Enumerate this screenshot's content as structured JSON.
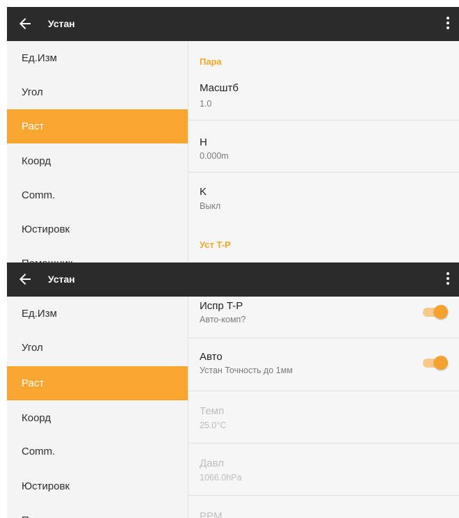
{
  "appbar": {
    "title": "Устан"
  },
  "sidebar": {
    "items": [
      {
        "label": "Ед.Изм"
      },
      {
        "label": "Угол"
      },
      {
        "label": "Раст"
      },
      {
        "label": "Коорд"
      },
      {
        "label": "Comm."
      },
      {
        "label": "Юстировк"
      },
      {
        "label": "Помощник"
      }
    ],
    "active_index": 2
  },
  "screen1": {
    "section_params": "Пара",
    "scale": {
      "title": "Масштб",
      "value": "1.0"
    },
    "h": {
      "title": "H",
      "value": "0.000m"
    },
    "k": {
      "title": "K",
      "value": "Выкл"
    },
    "section_tp": "Уст T-P"
  },
  "screen2": {
    "tp_correct": {
      "title": "Испр T-P",
      "subtitle": "Авто-комп?",
      "on": true
    },
    "auto": {
      "title": "Авто",
      "subtitle": "Устан Точность до 1мм",
      "on": true
    },
    "temp": {
      "title": "Темп",
      "value": "25.0°C"
    },
    "pressure": {
      "title": "Давл",
      "value": "1066.0hPa"
    },
    "ppm": {
      "title": "PPM"
    }
  },
  "colors": {
    "accent": "#f9a630",
    "appbar": "#2b2b2b"
  }
}
